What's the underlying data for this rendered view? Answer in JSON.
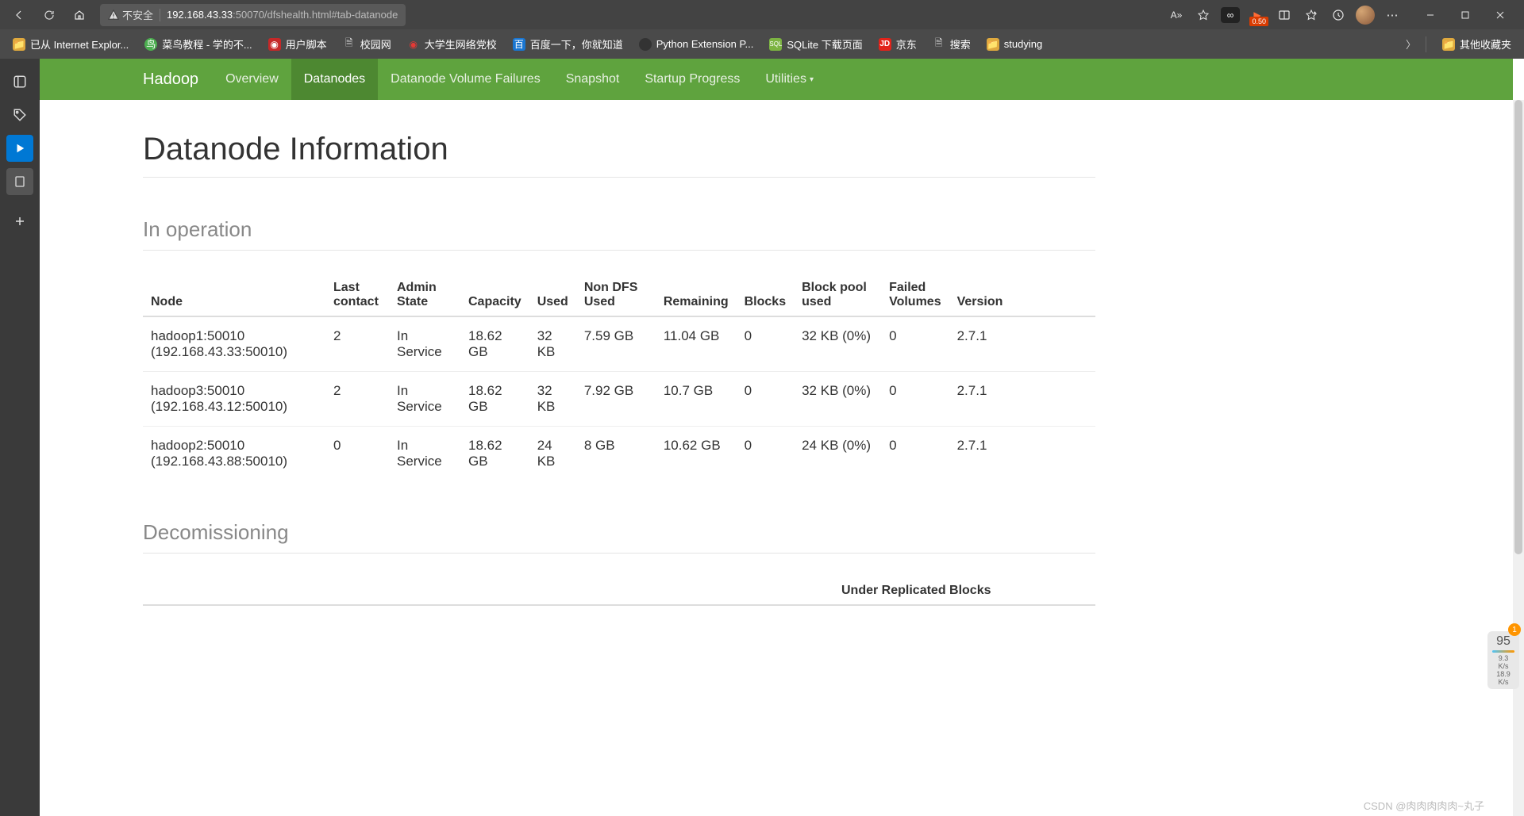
{
  "browser": {
    "security_label": "不安全",
    "url_host": "192.168.43.33",
    "url_path": ":50070/dfshealth.html#tab-datanode",
    "read_aloud": "A»",
    "ext_badge": "0.50"
  },
  "bookmarks": {
    "items": [
      {
        "label": "已从 Internet Explor...",
        "icon": "folder"
      },
      {
        "label": "菜鸟教程 - 学的不...",
        "icon": "green"
      },
      {
        "label": "用户脚本",
        "icon": "red"
      },
      {
        "label": "校园网",
        "icon": "page"
      },
      {
        "label": "大学生网络党校",
        "icon": "red"
      },
      {
        "label": "百度一下，你就知道",
        "icon": "blue"
      },
      {
        "label": "Python Extension P...",
        "icon": "dark"
      },
      {
        "label": "SQLite 下载页面",
        "icon": "sql"
      },
      {
        "label": "京东",
        "icon": "jd"
      },
      {
        "label": "搜索",
        "icon": "page"
      },
      {
        "label": "studying",
        "icon": "folder"
      }
    ],
    "other": "其他收藏夹"
  },
  "hadoop_nav": {
    "brand": "Hadoop",
    "tabs": [
      "Overview",
      "Datanodes",
      "Datanode Volume Failures",
      "Snapshot",
      "Startup Progress",
      "Utilities"
    ],
    "active": "Datanodes"
  },
  "page": {
    "title": "Datanode Information",
    "section_in_operation": "In operation",
    "section_decommissioning": "Decomissioning"
  },
  "table1": {
    "headers": [
      "Node",
      "Last contact",
      "Admin State",
      "Capacity",
      "Used",
      "Non DFS Used",
      "Remaining",
      "Blocks",
      "Block pool used",
      "Failed Volumes",
      "Version"
    ],
    "rows": [
      {
        "node": "hadoop1:50010 (192.168.43.33:50010)",
        "last": "2",
        "admin": "In Service",
        "cap": "18.62 GB",
        "used": "32 KB",
        "nondfs": "7.59 GB",
        "rem": "11.04 GB",
        "blocks": "0",
        "bp": "32 KB (0%)",
        "fv": "0",
        "ver": "2.7.1"
      },
      {
        "node": "hadoop3:50010 (192.168.43.12:50010)",
        "last": "2",
        "admin": "In Service",
        "cap": "18.62 GB",
        "used": "32 KB",
        "nondfs": "7.92 GB",
        "rem": "10.7 GB",
        "blocks": "0",
        "bp": "32 KB (0%)",
        "fv": "0",
        "ver": "2.7.1"
      },
      {
        "node": "hadoop2:50010 (192.168.43.88:50010)",
        "last": "0",
        "admin": "In Service",
        "cap": "18.62 GB",
        "used": "24 KB",
        "nondfs": "8 GB",
        "rem": "10.62 GB",
        "blocks": "0",
        "bp": "24 KB (0%)",
        "fv": "0",
        "ver": "2.7.1"
      }
    ]
  },
  "table2": {
    "header_partial": "Under Replicated Blocks"
  },
  "widget": {
    "badge": "1",
    "val1": "95",
    "val2": "9.3",
    "unit2": "K/s",
    "val3": "18.9",
    "unit3": "K/s"
  },
  "watermark": "CSDN @肉肉肉肉肉~丸子"
}
